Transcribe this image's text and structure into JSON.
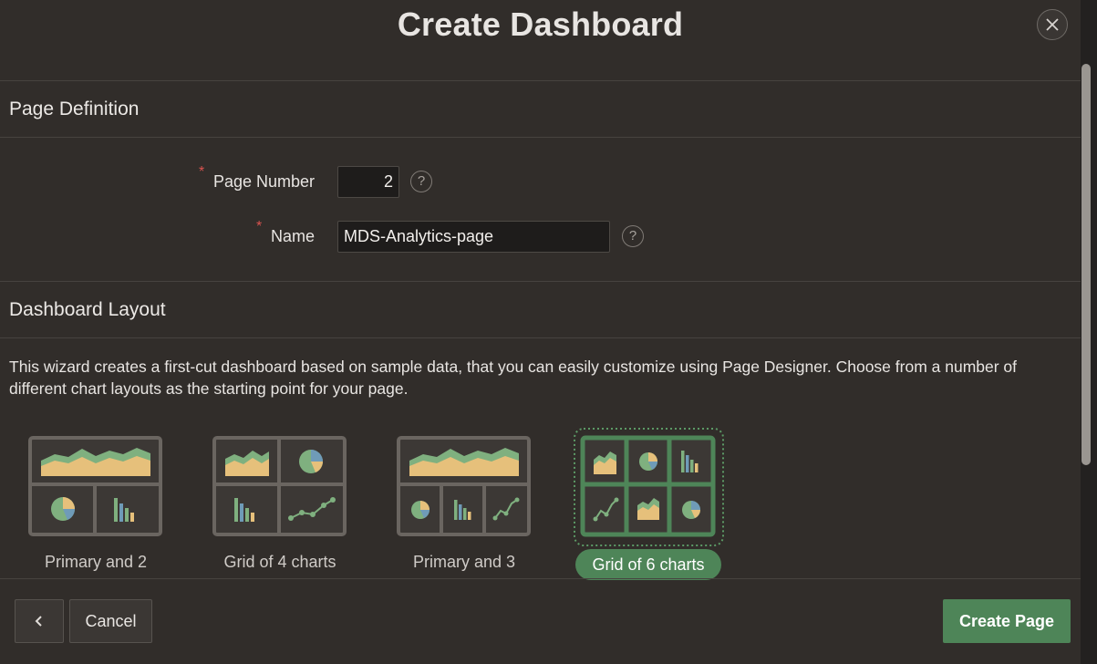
{
  "dialog": {
    "title": "Create Dashboard",
    "close_icon": "close-icon"
  },
  "page_definition": {
    "heading": "Page Definition",
    "page_number_label": "Page Number",
    "page_number_value": "2",
    "name_label": "Name",
    "name_value": "MDS-Analytics-page",
    "required_marker": "*",
    "help_glyph": "?"
  },
  "dashboard_layout": {
    "heading": "Dashboard Layout",
    "description": "This wizard creates a first-cut dashboard based on sample data, that you can easily customize using Page Designer. Choose from a number of different chart layouts as the starting point for your page.",
    "options": [
      {
        "label": "Primary and 2",
        "selected": false
      },
      {
        "label": "Grid of 4 charts",
        "selected": false
      },
      {
        "label": "Primary and 3",
        "selected": false
      },
      {
        "label": "Grid of 6 charts",
        "selected": true
      }
    ]
  },
  "footer": {
    "back_icon": "chevron-left-icon",
    "cancel_label": "Cancel",
    "create_label": "Create Page"
  },
  "colors": {
    "background": "#312d2a",
    "accent": "#4e8558",
    "chart_green": "#7fb07f",
    "chart_yellow": "#e6c07b",
    "chart_blue": "#6f9bb8",
    "required": "#d9534f"
  }
}
